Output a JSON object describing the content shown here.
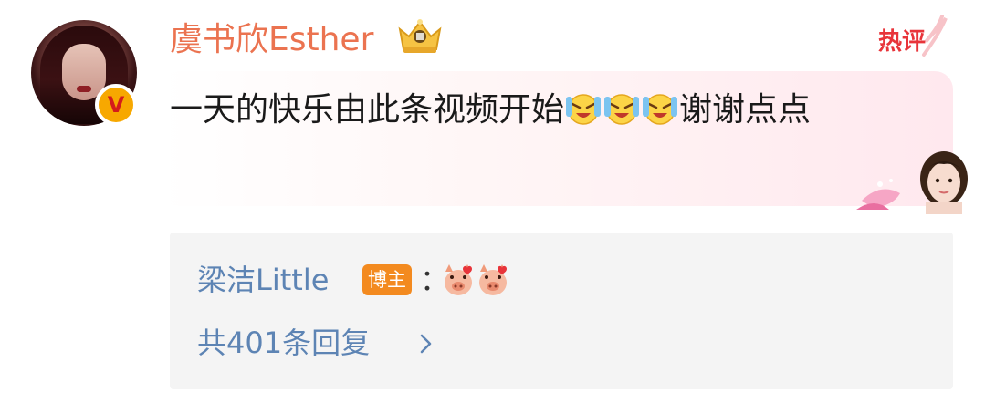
{
  "comment": {
    "username": "虞书欣Esther",
    "text_part1": "一天的快乐由此条视频开始",
    "text_part2": "谢谢点点",
    "emojis": [
      "laughing-crying-emoji",
      "laughing-crying-emoji",
      "laughing-crying-emoji"
    ],
    "hot_tag": "热评"
  },
  "reply": {
    "author": "梁洁Little",
    "badge": "博主",
    "colon": "：",
    "emojis": [
      "pig-heart-emoji",
      "pig-heart-emoji"
    ],
    "count_label": "共401条回复"
  },
  "colors": {
    "username": "#eb7350",
    "link": "#5d84b4",
    "badge_bg": "#f38a1f",
    "hot_tag": "#e8343a",
    "verified": "#f7a800"
  }
}
